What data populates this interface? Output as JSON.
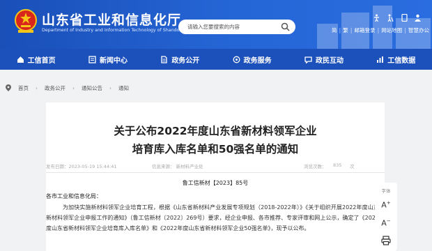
{
  "header": {
    "title": "山东省工业和信息化厅",
    "subtitle": "Department of Industry and Information Technology of Shandong Province",
    "search_placeholder": "请输入您要搜索的内容",
    "tools_top": [
      "简",
      "繁"
    ],
    "tools_bottom": [
      "邮箱登录",
      "网站地图",
      "智慧办公"
    ]
  },
  "nav": {
    "items": [
      {
        "label": "工信首页",
        "icon": "home-icon"
      },
      {
        "label": "新闻中心",
        "icon": "news-icon"
      },
      {
        "label": "政务公开",
        "icon": "document-icon"
      },
      {
        "label": "政务服务",
        "icon": "service-icon"
      },
      {
        "label": "政民互动",
        "icon": "chat-icon"
      },
      {
        "label": "工信数据",
        "icon": "data-icon"
      }
    ]
  },
  "breadcrumb": [
    "首页",
    "政务公开",
    "通知公告",
    "通知"
  ],
  "article": {
    "title_line1": "关于公布2022年度山东省新材料领军企业",
    "title_line2": "培育库入库名单和50强名单的通知",
    "publish_time": "发布日期：2023-05-19 15:44:41",
    "source": "信息来源：  新材料产业处",
    "views_label": "浏览次数：",
    "views": "835",
    "extra": "次",
    "doc_number": "鲁工信新材【2023】85号",
    "salutation": "各市工业和信息化局：",
    "paragraph": "为加快实施新材料领军企业培育工程，根据《山东省新材料产业发展专项规划（2018-2022年）》《关于组织开展2022年度山东省新材料领军企业申报工作的通知》（鲁工信新材〔2022〕269号）要求，经企业申报、各市推荐、专家评审和网上公示，确定了《2022年度山东省新材料领军企业培育库入库名单》和《2022年度山东省新材料领军企业50强名单》，现予以公布。"
  },
  "side_tools": {
    "font_label": "字体",
    "increase": "A",
    "decrease": "A"
  },
  "colors": {
    "brand_blue": "#1c50bb",
    "header_blue": "#2566d6",
    "page_bg": "#f1f2f4"
  }
}
